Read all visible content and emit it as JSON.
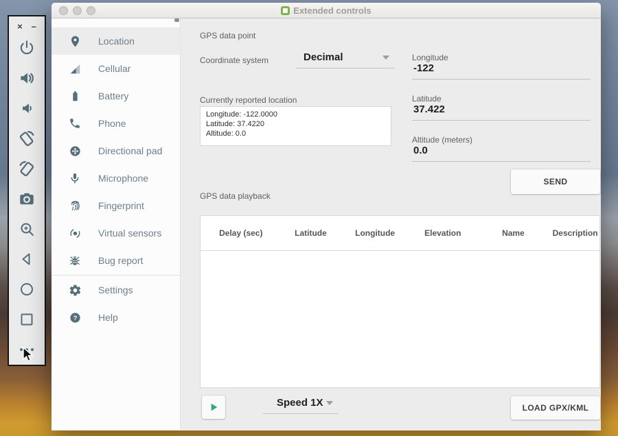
{
  "window": {
    "title": "Extended controls"
  },
  "emulator_toolbar": {
    "close_glyph": "×",
    "minimize_glyph": "–",
    "icons": [
      "power",
      "volume-up",
      "volume-down",
      "rotate-left",
      "rotate-right",
      "camera",
      "zoom",
      "back",
      "home",
      "overview",
      "more"
    ]
  },
  "sidebar": {
    "items": [
      {
        "label": "Location",
        "icon": "location-pin",
        "active": true
      },
      {
        "label": "Cellular",
        "icon": "cellular-signal"
      },
      {
        "label": "Battery",
        "icon": "battery"
      },
      {
        "label": "Phone",
        "icon": "phone"
      },
      {
        "label": "Directional pad",
        "icon": "dpad"
      },
      {
        "label": "Microphone",
        "icon": "microphone"
      },
      {
        "label": "Fingerprint",
        "icon": "fingerprint"
      },
      {
        "label": "Virtual sensors",
        "icon": "virtual-sensors"
      },
      {
        "label": "Bug report",
        "icon": "bug"
      },
      {
        "label": "Settings",
        "icon": "gear",
        "divider_before": true
      },
      {
        "label": "Help",
        "icon": "help"
      }
    ]
  },
  "gps": {
    "section_label": "GPS data point",
    "coordinate_system_label": "Coordinate system",
    "coordinate_system_value": "Decimal",
    "reported_label": "Currently reported location",
    "reported_lines": [
      "Longitude: -122.0000",
      "Latitude: 37.4220",
      "Altitude: 0.0"
    ],
    "longitude_label": "Longitude",
    "longitude_value": "-122",
    "latitude_label": "Latitude",
    "latitude_value": "37.422",
    "altitude_label": "Altitude (meters)",
    "altitude_value": "0.0",
    "send_label": "SEND"
  },
  "playback": {
    "section_label": "GPS data playback",
    "table_headers": [
      "Delay (sec)",
      "Latitude",
      "Longitude",
      "Elevation",
      "Name",
      "Description"
    ],
    "rows": [],
    "play_icon": "play",
    "speed_value": "Speed 1X",
    "load_label": "LOAD GPX/KML"
  },
  "colors": {
    "icon_slate": "#546e7a",
    "play_green": "#3aa77b",
    "app_icon_green": "#7ab648",
    "active_item_bg": "#ececec"
  }
}
